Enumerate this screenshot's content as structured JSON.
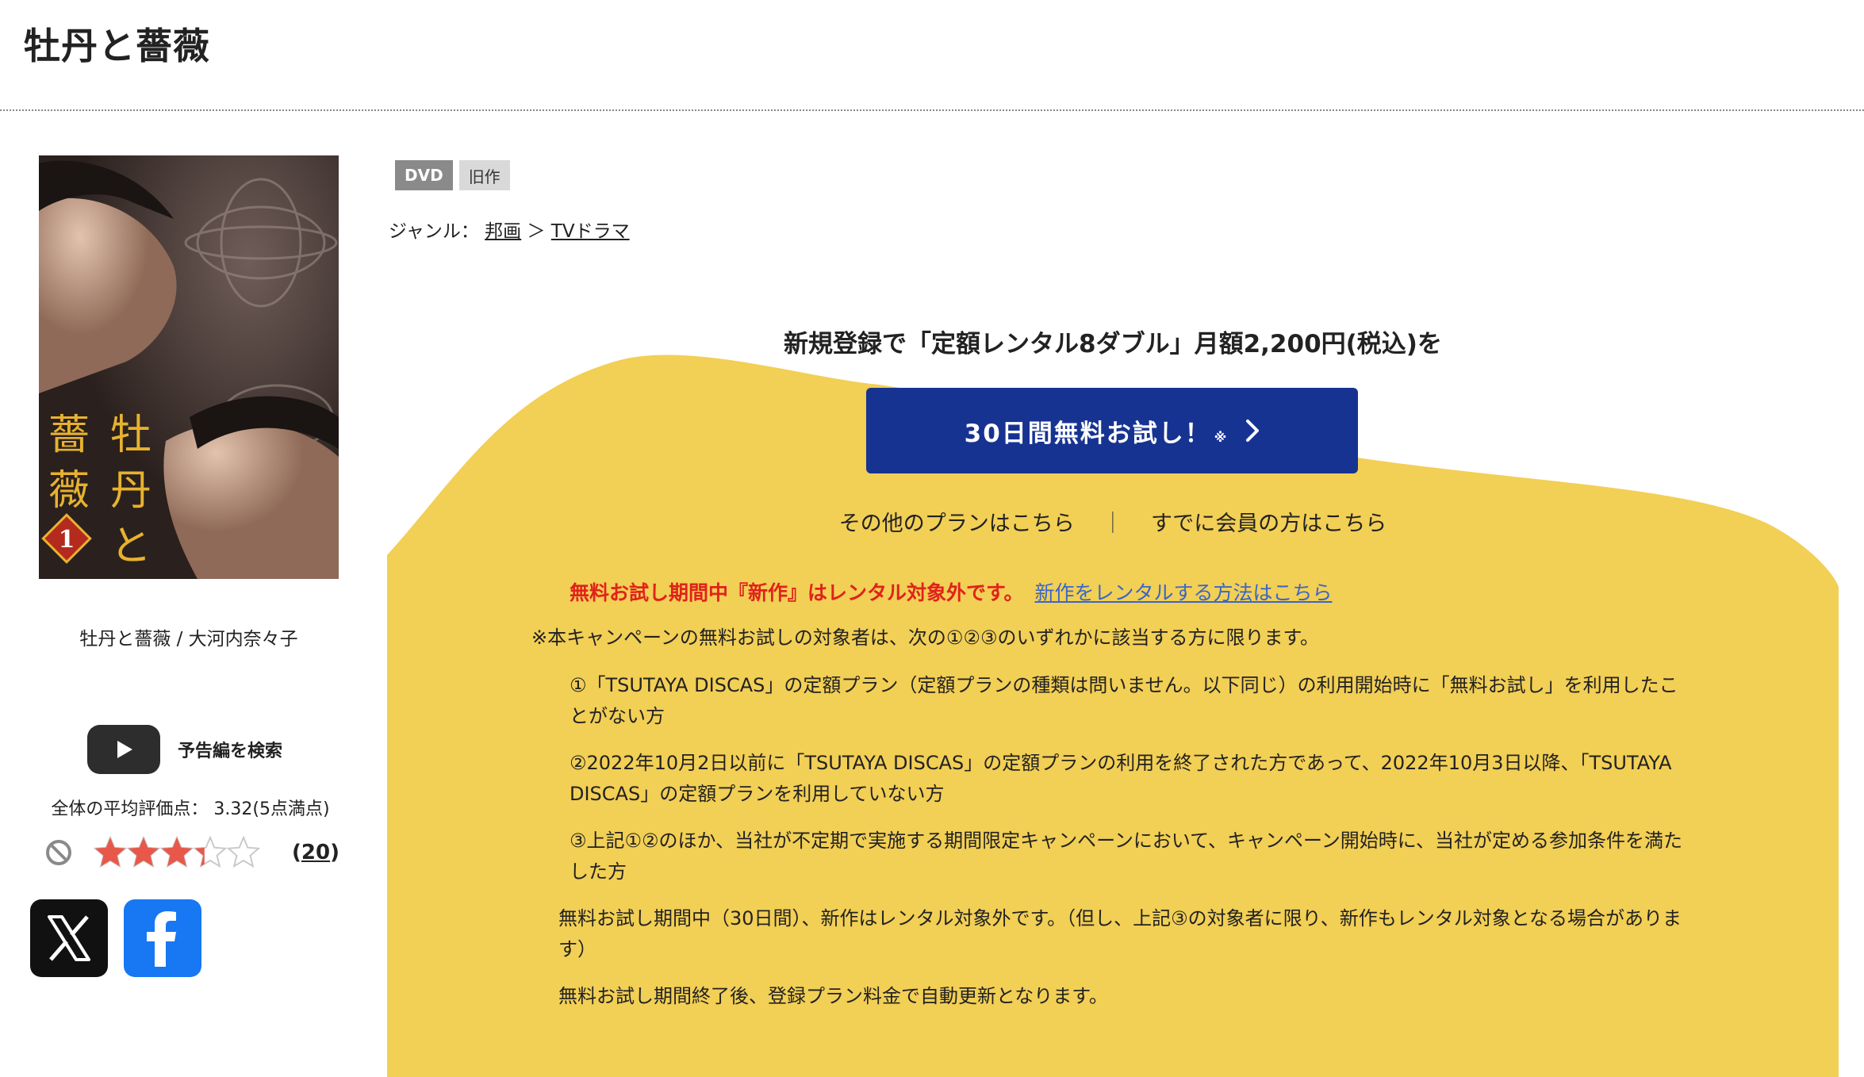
{
  "page": {
    "title": "牡丹と薔薇"
  },
  "product": {
    "cover_title_chars": "牡丹と薔薇",
    "cover_volume": "1",
    "caption": "牡丹と薔薇 / 大河内奈々子",
    "trailer_label": "予告編を検索",
    "rating_label": "全体の平均評価点： 3.32(5点満点)",
    "rating_value": 3.32,
    "rating_max": 5,
    "review_count": "20",
    "review_open": "(",
    "review_close": ")"
  },
  "badges": {
    "format": "DVD",
    "release": "旧作"
  },
  "genre": {
    "label": "ジャンル：",
    "items": [
      {
        "label": "邦画"
      },
      {
        "label": "TVドラマ"
      }
    ],
    "separator": "＞"
  },
  "promo": {
    "headline": "新規登録で「定額レンタル8ダブル」月額2,200円(税込)を",
    "cta_label": "30日間無料お試し！",
    "cta_note": "※",
    "link_other_plans": "その他のプランはこちら",
    "link_separator": "｜",
    "link_member": "すでに会員の方はこちら",
    "notice_red": "無料お試し期間中『新作』はレンタル対象外です。",
    "notice_link": "新作をレンタルする方法はこちら",
    "terms_intro": "※本キャンペーンの無料お試しの対象者は、次の①②③のいずれかに該当する方に限ります。",
    "term_1": "①「TSUTAYA DISCAS」の定額プラン（定額プランの種類は問いません。以下同じ）の利用開始時に「無料お試し」を利用したことがない方",
    "term_2": "②2022年10月2日以前に「TSUTAYA DISCAS」の定額プランの利用を終了された方であって、2022年10月3日以降、「TSUTAYA DISCAS」の定額プランを利用していない方",
    "term_3": "③上記①②のほか、当社が不定期で実施する期間限定キャンペーンにおいて、キャンペーン開始時に、当社が定める参加条件を満たした方",
    "term_4": "無料お試し期間中（30日間）、新作はレンタル対象外です。（但し、上記③の対象者に限り、新作もレンタル対象となる場合があります）",
    "term_5": "無料お試し期間終了後、登録プラン料金で自動更新となります。"
  },
  "icons": {
    "play": "youtube-play-icon",
    "no_rating": "no-entry-icon",
    "x": "x-logo-icon",
    "facebook": "facebook-logo-icon",
    "chevron": "chevron-right-icon"
  },
  "colors": {
    "promo_yellow": "#f2cf55",
    "cta_blue": "#173392",
    "notice_red": "#e0231b",
    "link_blue": "#3a66c8",
    "star_filled": "#e8584a",
    "facebook_blue": "#1877f2"
  }
}
